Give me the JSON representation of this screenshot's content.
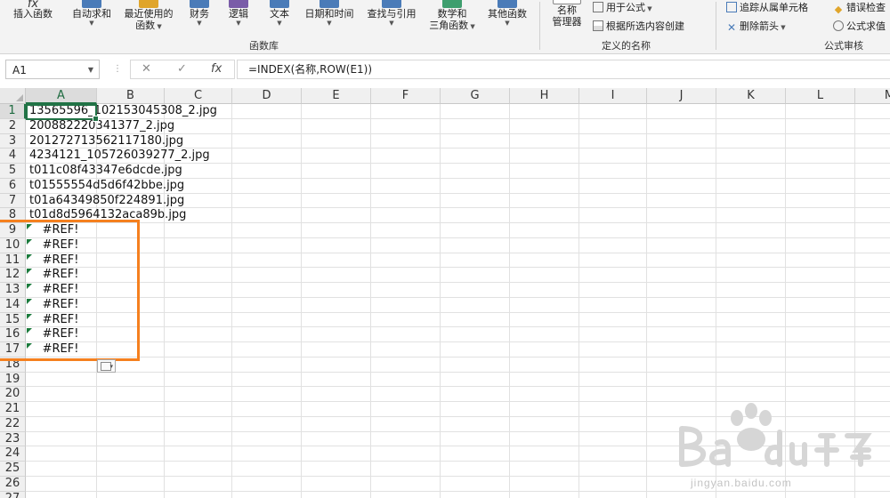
{
  "ribbon": {
    "insert_function": "插入函数",
    "autosum": "自动求和",
    "recent": [
      "最近使用的",
      "函数"
    ],
    "financial": "财务",
    "logical": "逻辑",
    "text": "文本",
    "datetime": "日期和时间",
    "lookup": "查找与引用",
    "math": [
      "数学和",
      "三角函数"
    ],
    "other": "其他函数",
    "group_library": "函数库",
    "name_manager": [
      "名称",
      "管理器"
    ],
    "use_in_formula": "用于公式",
    "create_from_selection": "根据所选内容创建",
    "group_defined_names": "定义的名称",
    "trace_precedents": "追踪从属单元格",
    "remove_arrows": "删除箭头",
    "error_checking": "错误检查",
    "evaluate_formula": "公式求值",
    "group_auditing": "公式审核"
  },
  "formula_bar": {
    "name_box": "A1",
    "cancel_icon": "✕",
    "enter_icon": "✓",
    "fx_label": "fx",
    "formula": "=INDEX(名称,ROW(E1))"
  },
  "columns": [
    "A",
    "B",
    "C",
    "D",
    "E",
    "F",
    "G",
    "H",
    "I",
    "J",
    "K",
    "L",
    "M"
  ],
  "rows": [
    "1",
    "2",
    "3",
    "4",
    "5",
    "6",
    "7",
    "8",
    "9",
    "10",
    "11",
    "12",
    "13",
    "14",
    "15",
    "16",
    "17",
    "18",
    "19",
    "20",
    "21",
    "22",
    "23",
    "24",
    "25",
    "26",
    "27"
  ],
  "cells": [
    "13565596_102153045308_2.jpg",
    "200882220341377_2.jpg",
    "201272713562117180.jpg",
    "4234121_105726039277_2.jpg",
    "t011c08f43347e6dcde.jpg",
    "t01555554d5d6f42bbe.jpg",
    "t01a64349850f224891.jpg",
    "t01d8d5964132aca89b.jpg",
    "#REF!",
    "#REF!",
    "#REF!",
    "#REF!",
    "#REF!",
    "#REF!",
    "#REF!",
    "#REF!",
    "#REF!"
  ],
  "watermark": {
    "sub": "jingyan.baidu.com"
  },
  "colors": {
    "accent": "#217346",
    "highlight": "#f5801f",
    "error_marker": "#1b7a3c"
  }
}
